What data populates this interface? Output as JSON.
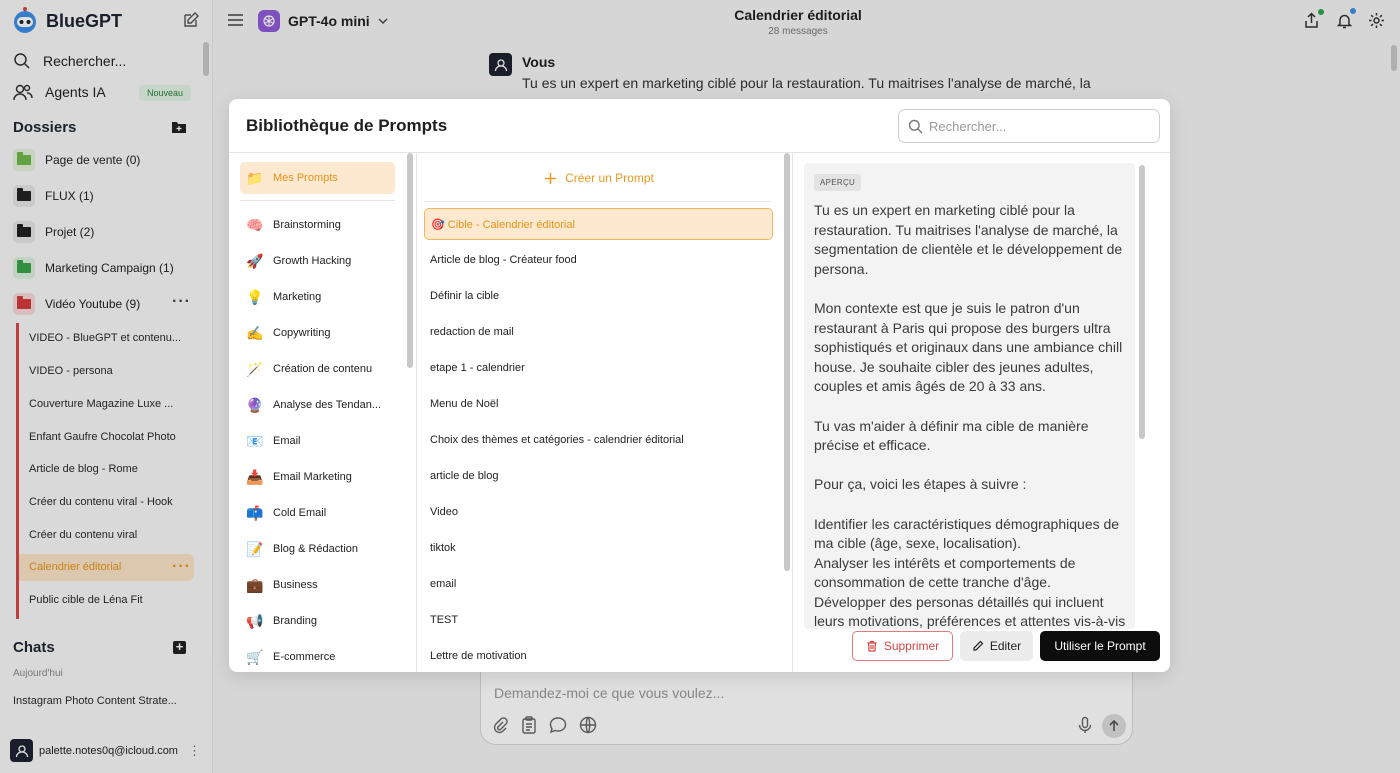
{
  "app": {
    "name": "BlueGPT",
    "search_label": "Rechercher...",
    "agents_label": "Agents IA",
    "agents_badge": "Nouveau",
    "folders_title": "Dossiers",
    "folders": [
      {
        "label": "Page de vente (0)",
        "color": "#6fb84c"
      },
      {
        "label": "FLUX (1)",
        "color": "#222222"
      },
      {
        "label": "Projet (2)",
        "color": "#222222"
      },
      {
        "label": "Marketing Campaign (1)",
        "color": "#3aa34a"
      },
      {
        "label": "Vidéo Youtube (9)",
        "color": "#d63b3b"
      }
    ],
    "subitems": [
      "VIDEO - BlueGPT et contenu...",
      "VIDEO - persona",
      "Couverture Magazine Luxe ...",
      "Enfant Gaufre Chocolat Photo",
      "Article de blog - Rome",
      "Créer du contenu viral - Hook",
      "Créer du contenu viral",
      "Calendrier éditorial",
      "Public cible de Léna Fit"
    ],
    "chats_title": "Chats",
    "today_label": "Aujourd'hui",
    "chat_items": [
      "Instagram Photo Content Strate..."
    ],
    "user_email": "palette.notes0q@icloud.com"
  },
  "header": {
    "model": "GPT-4o mini",
    "title": "Calendrier éditorial",
    "subtitle": "28 messages"
  },
  "message": {
    "author": "Vous",
    "text": "Tu es un expert en marketing ciblé pour la restauration. Tu maitrises l'analyse de marché, la"
  },
  "composer": {
    "placeholder": "Demandez-moi ce que vous voulez..."
  },
  "modal": {
    "title": "Bibliothèque de Prompts",
    "search_placeholder": "Rechercher...",
    "categories": [
      {
        "label": "Mes Prompts",
        "icon": "📁"
      },
      {
        "label": "Brainstorming",
        "icon": "🧠"
      },
      {
        "label": "Growth Hacking",
        "icon": "🚀"
      },
      {
        "label": "Marketing",
        "icon": "💡"
      },
      {
        "label": "Copywriting",
        "icon": "✍"
      },
      {
        "label": "Création de contenu",
        "icon": "🪄"
      },
      {
        "label": "Analyse des Tendan...",
        "icon": "🔮"
      },
      {
        "label": "Email",
        "icon": "📧"
      },
      {
        "label": "Email Marketing",
        "icon": "📥"
      },
      {
        "label": "Cold Email",
        "icon": "📫"
      },
      {
        "label": "Blog & Rédaction",
        "icon": "📝"
      },
      {
        "label": "Business",
        "icon": "💼"
      },
      {
        "label": "Branding",
        "icon": "📢"
      },
      {
        "label": "E-commerce",
        "icon": "🛒"
      }
    ],
    "create_label": "Créer un Prompt",
    "prompts": [
      "🎯 Cible - Calendrier éditorial",
      "Article de blog - Créateur food",
      "Définir la cible",
      "redaction de mail",
      "etape 1 - calendrier",
      "Menu de Noël",
      "Choix des thèmes et catégories - calendrier éditorial",
      "article de blog",
      "Video",
      "tiktok",
      "email",
      "TEST",
      "Lettre de motivation"
    ],
    "preview_label": "APERÇU",
    "preview_text": "Tu es un expert en marketing ciblé pour la restauration. Tu maitrises l'analyse de marché, la segmentation de clientèle et le développement de persona.\n\nMon contexte est que je suis le patron d'un restaurant à Paris qui propose des burgers ultra sophistiqués et originaux dans une ambiance chill house. Je souhaite cibler des jeunes adultes, couples et amis âgés de 20 à 33 ans.\n\nTu vas m'aider à définir ma cible de manière précise et efficace.\n\nPour ça, voici les étapes à suivre :\n\nIdentifier les caractéristiques démographiques de ma cible (âge, sexe, localisation).\nAnalyser les intérêts et comportements de consommation de cette tranche d'âge.\nDévelopper des personas détaillés qui incluent leurs motivations, préférences et attentes vis-à-vis",
    "delete_label": "Supprimer",
    "edit_label": "Editer",
    "use_label": "Utiliser le Prompt"
  },
  "colors": {
    "accent": "#e5941a",
    "accent_bg": "#fde9d0",
    "danger": "#d64545",
    "brand": "#1d2330"
  }
}
